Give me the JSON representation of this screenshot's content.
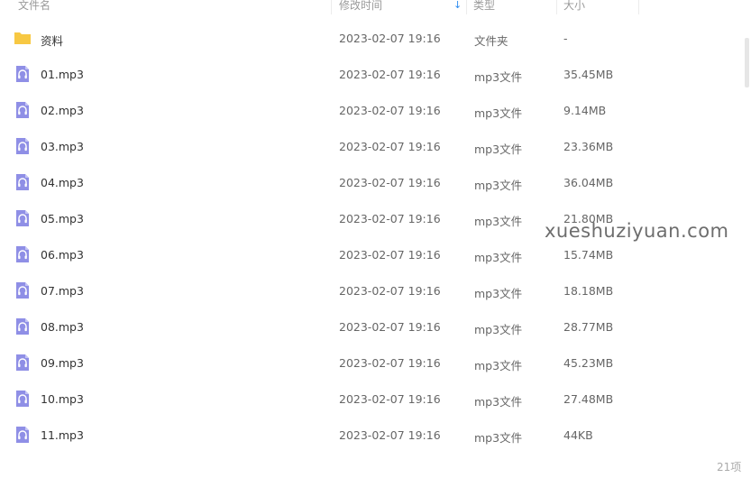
{
  "header": {
    "name_label": "文件名",
    "date_label": "修改时间",
    "type_label": "类型",
    "size_label": "大小",
    "sort_indicator": "↓"
  },
  "colors": {
    "folder": "#f7c843",
    "audio_icon": "#8f8fe6",
    "sort_accent": "#2d8cf0"
  },
  "files": [
    {
      "name": "资料",
      "date": "2023-02-07 19:16",
      "type": "文件夹",
      "size": "-",
      "icon": "folder-icon"
    },
    {
      "name": "01.mp3",
      "date": "2023-02-07 19:16",
      "type": "mp3文件",
      "size": "35.45MB",
      "icon": "audio-file-icon"
    },
    {
      "name": "02.mp3",
      "date": "2023-02-07 19:16",
      "type": "mp3文件",
      "size": "9.14MB",
      "icon": "audio-file-icon"
    },
    {
      "name": "03.mp3",
      "date": "2023-02-07 19:16",
      "type": "mp3文件",
      "size": "23.36MB",
      "icon": "audio-file-icon"
    },
    {
      "name": "04.mp3",
      "date": "2023-02-07 19:16",
      "type": "mp3文件",
      "size": "36.04MB",
      "icon": "audio-file-icon"
    },
    {
      "name": "05.mp3",
      "date": "2023-02-07 19:16",
      "type": "mp3文件",
      "size": "21.80MB",
      "icon": "audio-file-icon"
    },
    {
      "name": "06.mp3",
      "date": "2023-02-07 19:16",
      "type": "mp3文件",
      "size": "15.74MB",
      "icon": "audio-file-icon"
    },
    {
      "name": "07.mp3",
      "date": "2023-02-07 19:16",
      "type": "mp3文件",
      "size": "18.18MB",
      "icon": "audio-file-icon"
    },
    {
      "name": "08.mp3",
      "date": "2023-02-07 19:16",
      "type": "mp3文件",
      "size": "28.77MB",
      "icon": "audio-file-icon"
    },
    {
      "name": "09.mp3",
      "date": "2023-02-07 19:16",
      "type": "mp3文件",
      "size": "45.23MB",
      "icon": "audio-file-icon"
    },
    {
      "name": "10.mp3",
      "date": "2023-02-07 19:16",
      "type": "mp3文件",
      "size": "27.48MB",
      "icon": "audio-file-icon"
    },
    {
      "name": "11.mp3",
      "date": "2023-02-07 19:16",
      "type": "mp3文件",
      "size": "44KB",
      "icon": "audio-file-icon"
    }
  ],
  "watermark": "xueshuziyuan.com",
  "footer": {
    "count": "21项"
  }
}
